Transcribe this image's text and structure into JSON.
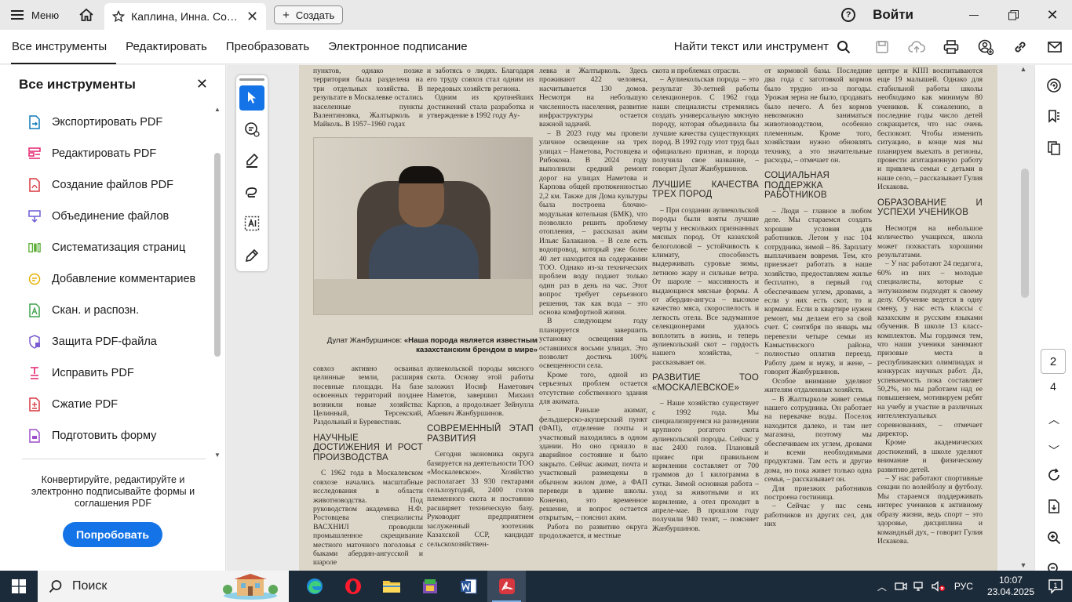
{
  "titlebar": {
    "menu_label": "Меню",
    "tab_title": "Каплина, Инна. Сох...",
    "new_tab_label": "Создать",
    "sign_in": "Войти"
  },
  "toolbar": {
    "tabs": [
      "Все инструменты",
      "Редактировать",
      "Преобразовать",
      "Электронное подписание"
    ],
    "find_label": "Найти текст или инструмент"
  },
  "left_panel": {
    "title": "Все инструменты",
    "items": [
      {
        "label": "Экспортировать PDF",
        "icon": "export-pdf-icon",
        "color": "#0d7ab8"
      },
      {
        "label": "Редактировать PDF",
        "icon": "edit-pdf-icon",
        "color": "#e3236e"
      },
      {
        "label": "Создание файлов PDF",
        "icon": "create-pdf-icon",
        "color": "#d7373f"
      },
      {
        "label": "Объединение файлов",
        "icon": "combine-files-icon",
        "color": "#6b5fd6"
      },
      {
        "label": "Систематизация страниц",
        "icon": "organize-pages-icon",
        "color": "#5cae37"
      },
      {
        "label": "Добавление комментариев",
        "icon": "comment-icon",
        "color": "#e6b000"
      },
      {
        "label": "Скан. и распозн.",
        "icon": "scan-ocr-icon",
        "color": "#3fa34d"
      },
      {
        "label": "Защита PDF-файла",
        "icon": "protect-pdf-icon",
        "color": "#7a5bd0"
      },
      {
        "label": "Исправить PDF",
        "icon": "fix-pdf-icon",
        "color": "#e3236e"
      },
      {
        "label": "Сжатие PDF",
        "icon": "compress-pdf-icon",
        "color": "#d7373f"
      },
      {
        "label": "Подготовить форму",
        "icon": "prepare-form-icon",
        "color": "#9d4ec9"
      }
    ],
    "promo_text": "Конвертируйте, редактируйте и электронно подписывайте формы и соглашения PDF",
    "try_button": "Попробовать"
  },
  "document": {
    "col1_top": "пунктов, однако позже территория была разделена на три отдельных хозяйства. В результате в Москалевке остались населенные пункты Валентиновка, Жалтырколь и Майколь. В 1957–1960 годах",
    "col2_top": "и заботясь о людях. Благодаря его труду совхоз стал одним из передовых хозяйств региона.",
    "col2_top_b": "Одним из крупнейших достижений стала разработка и утверждение в 1992 году Ау-",
    "caption_name": "Дулат Жанбуршинов:",
    "caption_quote": "«Наша порода является известным казахстанским брендом в мире»",
    "col1_bottom": "совхоз активно осваивал целинные земли, расширяя посевные площади. На базе освоенных территорий позднее возникли новые хозяйства: Целинный, Терсекский, Раздольный и Буревестник.",
    "heading_1": "Научные достижения и рост производства",
    "col1_bottom_b": "С 1962 года в Москалевском совхозе начались масштабные исследования в области животноводства. Под руководством академика Н.Ф. Ростовцева специалисты ВАСХНИЛ проводили промышленное скрещивание местного маточного поголовья с быками абердин-ангусской и шароле",
    "col2_bottom": "аулиекольской породы мясного скота. Основу этой работы заложил Иосиф Наметович Наметов, завершил Михаил Карпов, а продолжает Зейнулла Абаевич Жанбуршинов.",
    "heading_2": "Современный этап развития",
    "col2_bottom_b": "Сегодня экономика округа базируется на деятельности ТОО «Москалевское». Хозяйство располагает 33 930 гектарами сельхозугодий, 2400 голов племенного скота и постоянно расширяет техническую базу. Руководит предприятием заслуженный зоотехник Казахской ССР, кандидат сельскохозяйствен-",
    "col3": "левка и Жалтырколь. Здесь проживают 422 человека, насчитывается 130 домов. Несмотря на небольшую численность населения, развитие инфраструктуры остается важной задачей.",
    "col3_b": "– В 2023 году мы провели уличное освещение на трех улицах – Наметова, Ростовцева и Рибокона. В 2024 году выполнили средний ремонт дорог на улицах Наметова и Карпова общей протяженностью 2,2 км. Также для Дома культуры была построена блочно-модульная котельная (БМК), что позволило решить проблему отопления, – рассказал аким Ильяс Балаканов. – В селе есть водопровод, который уже более 40 лет находится на содержании ТОО. Однако из-за технических проблем воду подают только один раз в день на час. Этот вопрос требует серьезного решения, так как вода – это основа комфортной жизни.",
    "col3_c": "В следующем году планируется завершить установку освещения на оставшихся восьми улицах. Это позволит достичь 100% освещенности села.",
    "col3_d": "Кроме того, одной из серьезных проблем остается отсутствие собственного здания для акимата.",
    "col3_e": "– Раньше акимат, фельдшерско-акушерский пункт (ФАП), отделение почты и участковый находились в одном здании. Но оно пришло в аварийное состояние и было закрыто. Сейчас акимат, почта и участковый размещены в обычном жилом доме, а ФАП переведи в здание школы. Конечно, это временное решение, и вопрос остается открытым, – пояснил аким.",
    "col3_f": "Работа по развитию округа продолжается, и местные",
    "col4": "скота и проблемах отрасли.",
    "col4_b": "– Аулиекольская порода – это результат 30-летней работы селекционеров. С 1962 года наши специалисты стремились создать универсальную мясную породу, которая объединила бы лучшие качества существующих пород. В 1992 году этот труд был официально признан, и порода получила свое название, – говорит Дулат Жанбуршинов.",
    "heading_3": "Лучшие качества трех пород",
    "col4_c": "– При создании аулиекольской породы были взяты лучшие черты у нескольких признанных мясных пород. От казахской белоголовой – устойчивость к климату, способность выдерживать суровые зимы, летнюю жару и сильные ветра. От шароле – массивность и выдающиеся мясные формы. А от абердин-ангуса – высокое качество мяса, скороспелость и легкость отела. Все задуманное селекционерами удалось воплотить в жизнь, и теперь аулиекольский скот – гордость нашего хозяйства, – рассказывает он.",
    "heading_4": "Развитие ТОО «Москалевское»",
    "col4_d": "– Наше хозяйство существует с 1992 года. Мы специализируемся на разведении крупного рогатого скота аулиекольской породы. Сейчас у нас 2400 голов. Плановый привес при правильном кормлении составляет от 700 граммов до 1 килограмма в сутки. Зимой основная работа – уход за животными и их кормление, а отел проходит в апреле-мае. В прошлом году получили 940 телят, – поясняет Жанбуршинов.",
    "col5": "от кормовой базы. Последние два года с заготовкой кормов было трудно из-за погоды. Урожая зерна не было, продавать было нечего. А без кормов невозможно заниматься животноводством, особенно племенным. Кроме того, хозяйствам нужно обновлять технику, а это значительные расходы, – отмечает он.",
    "heading_5": "Социальная поддержка работников",
    "col5_b": "– Люди – главное в любом деле. Мы стараемся создать хорошие условия для работников. Летом у нас 104 сотрудника, зимой – 86. Зарплату выплачиваем вовремя. Тем, кто приезжает работать в наше хозяйство, предоставляем жилье бесплатно, в первый год обеспечиваем углем, дровами, а если у них есть скот, то и кормами. Если в квартире нужен ремонт, мы делаем его за свой счет. С сентября по январь мы перевезли четыре семьи из Камыстинского района, полностью оплатив переезд. Работу даем и мужу, и жене, – говорит Жанбуршинов.",
    "col5_c": "Особое внимание уделяют жителям отдаленных хозяйств.",
    "col5_d": "– В Жалтырколе живет семья нашего сотрудника. Он работает на перекачке воды. Поселок находится далеко, и там нет магазина, поэтому мы обеспечиваем их углем, дровами и всеми необходимыми продуктами. Там есть и другие дома, но пока живет только одна семья, – рассказывает он.",
    "col5_e": "Для приезжих работников построена гостиница.",
    "col5_f": "– Сейчас у нас семь работников из других сел, для них",
    "col6": "центре и КПП воспитываются еще 19 малышей. Однако для стабильной работы школы необходимо как минимум 80 учеников. К сожалению, в последние годы число детей сокращается, что нас очень беспокоит. Чтобы изменить ситуацию, в конце мая мы планируем выехать в регионы, провести агитационную работу и привлечь семьи с детьми в наше село, – рассказывает Гулия Искакова.",
    "heading_6": "Образование и успехи учеников",
    "col6_b": "Несмотря на небольшое количество учащихся, школа может похвастать хорошими результатами.",
    "col6_c": "– У нас работают 24 педагога, 60% из них – молодые специалисты, которые с энтузиазмом подходят к своему делу. Обучение ведется в одну смену, у нас есть классы с казахским и русским языками обучения. В школе 13 класс-комплектов. Мы гордимся тем, что наши ученики занимают призовые места в республиканских олимпиадах и конкурсах научных работ. Да, успеваемость пока составляет 50,2%, но мы работаем над ее повышением, мотивируем ребят на учебу и участие в различных интеллектуальных соревнованиях, – отмечает директор.",
    "col6_d": "Кроме академических достижений, в школе уделяют внимание и физическому развитию детей.",
    "col6_e": "– У нас работают спортивные секции по волейболу и футболу. Мы стараемся поддерживать интерес учеников к активному образу жизни, ведь спорт – это здоровье, дисциплина и командный дух, – говорит Гулия Искакова."
  },
  "right_rail": {
    "current_page": "2",
    "total_pages": "4"
  },
  "taskbar": {
    "search_placeholder": "Поиск",
    "language": "РУС",
    "time": "10:07",
    "date": "23.04.2025",
    "notification_count": "1"
  }
}
